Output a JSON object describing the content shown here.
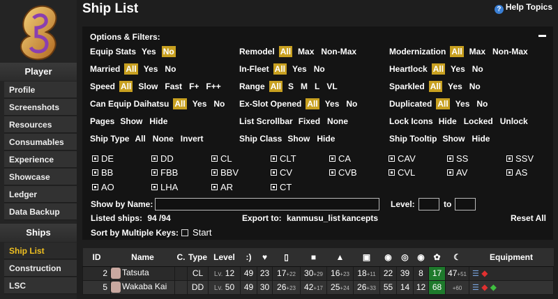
{
  "page_title": "Ship List",
  "help_label": "Help Topics",
  "sidebar": {
    "player_header": "Player",
    "player_items": [
      "Profile",
      "Screenshots",
      "Resources",
      "Consumables",
      "Experience",
      "Showcase",
      "Ledger",
      "Data Backup"
    ],
    "ships_header": "Ships",
    "ships_items": [
      "Ship List",
      "Construction",
      "LSC"
    ]
  },
  "filters": {
    "title": "Options & Filters:",
    "equip_stats": {
      "label": "Equip Stats",
      "opts": [
        "Yes",
        "No"
      ]
    },
    "married": {
      "label": "Married",
      "opts": [
        "All",
        "Yes",
        "No"
      ]
    },
    "speed": {
      "label": "Speed",
      "opts": [
        "All",
        "Slow",
        "Fast",
        "F+",
        "F++"
      ]
    },
    "daihatsu": {
      "label": "Can Equip Daihatsu",
      "opts": [
        "All",
        "Yes",
        "No"
      ]
    },
    "pages": {
      "label": "Pages",
      "opts": [
        "Show",
        "Hide"
      ]
    },
    "ship_type": {
      "label": "Ship Type",
      "opts": [
        "All",
        "None",
        "Invert"
      ]
    },
    "remodel": {
      "label": "Remodel",
      "opts": [
        "All",
        "Max",
        "Non-Max"
      ]
    },
    "in_fleet": {
      "label": "In-Fleet",
      "opts": [
        "All",
        "Yes",
        "No"
      ]
    },
    "range": {
      "label": "Range",
      "opts": [
        "All",
        "S",
        "M",
        "L",
        "VL"
      ]
    },
    "exslot": {
      "label": "Ex-Slot Opened",
      "opts": [
        "All",
        "Yes",
        "No"
      ]
    },
    "list_scrollbar": {
      "label": "List Scrollbar",
      "opts": [
        "Fixed",
        "None"
      ]
    },
    "ship_class": {
      "label": "Ship Class",
      "opts": [
        "Show",
        "Hide"
      ]
    },
    "modernization": {
      "label": "Modernization",
      "opts": [
        "All",
        "Max",
        "Non-Max"
      ]
    },
    "heartlock": {
      "label": "Heartlock",
      "opts": [
        "All",
        "Yes",
        "No"
      ]
    },
    "sparkled": {
      "label": "Sparkled",
      "opts": [
        "All",
        "Yes",
        "No"
      ]
    },
    "duplicated": {
      "label": "Duplicated",
      "opts": [
        "All",
        "Yes",
        "No"
      ]
    },
    "lock_icons": {
      "label": "Lock Icons",
      "opts": [
        "Hide",
        "Locked",
        "Unlock"
      ]
    },
    "ship_tooltip": {
      "label": "Ship Tooltip",
      "opts": [
        "Show",
        "Hide"
      ]
    },
    "ship_types": [
      "DE",
      "DD",
      "CL",
      "CLT",
      "CA",
      "CAV",
      "SS",
      "SSV",
      "BB",
      "FBB",
      "BBV",
      "CV",
      "CVB",
      "CVL",
      "AV",
      "AS",
      "AO",
      "LHA",
      "AR",
      "CT"
    ],
    "show_by_name": "Show by Name:",
    "level_label": "Level:",
    "to_label": "to",
    "listed_label": "Listed ships:",
    "listed_value": "94 /94",
    "export_label": "Export to:",
    "export_opts": [
      "kanmusu_list",
      "kancepts"
    ],
    "reset_all": "Reset All",
    "sort_label": "Sort by Multiple Keys:",
    "start_label": "Start"
  },
  "table": {
    "headers": [
      "ID",
      "Name",
      "C.",
      "Type",
      "Level",
      ":)"
    ],
    "equipment_header": "Equipment",
    "rows": [
      {
        "id": "2",
        "name": "Tatsuta",
        "type": "CL",
        "lv_prefix": "Lv.",
        "level": "12",
        "morale": "49",
        "hp": "23",
        "fp": "17",
        "fp_x": "+22",
        "tp": "30",
        "tp_x": "+29",
        "aa": "16",
        "aa_x": "+23",
        "ar": "18",
        "ar_x": "+11",
        "asw": "22",
        "ev": "39",
        "los": "8",
        "luck": "17",
        "speed": "47",
        "speed_x": "+51"
      },
      {
        "id": "5",
        "name": "Wakaba Kai",
        "type": "DD",
        "lv_prefix": "Lv.",
        "level": "50",
        "morale": "49",
        "hp": "30",
        "fp": "26",
        "fp_x": "+23",
        "tp": "42",
        "tp_x": "+17",
        "aa": "25",
        "aa_x": "+24",
        "ar": "26",
        "ar_x": "+33",
        "asw": "55",
        "ev": "14",
        "los": "12",
        "luck": "68",
        "speed_x": "+60"
      }
    ]
  },
  "colors": {
    "highlight": "#c8a020",
    "active_nav": "#f0c020",
    "stat_green": "#1e7a2c"
  }
}
